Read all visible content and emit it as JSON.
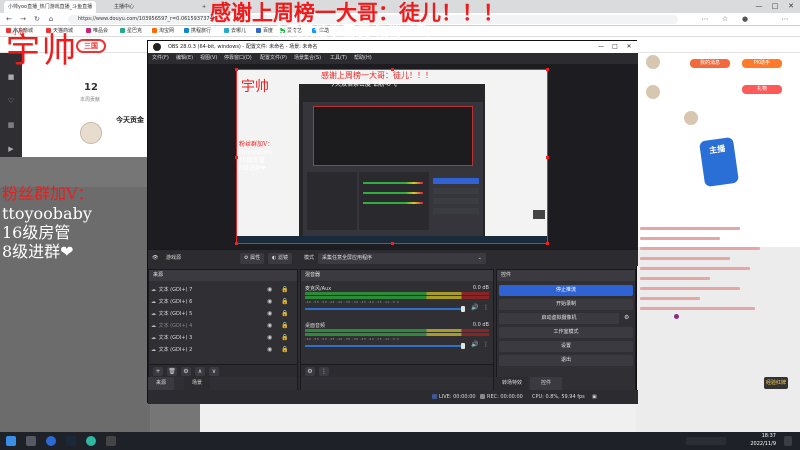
{
  "browser": {
    "tabs": [
      {
        "label": "小帅yoo直播_热门游戏直播_斗鱼直播",
        "active": true
      },
      {
        "label": "主播中心",
        "active": false
      }
    ],
    "new_tab": "+",
    "url": "https://www.douyu.com/103956597_r=0.0615937374",
    "bookmarks": [
      "京东商城",
      "天猫商城",
      "唯品会",
      "星巴克",
      "淘宝网",
      "携程旅行",
      "去哪儿",
      "百度",
      "爱奇艺",
      "优酷"
    ],
    "controls": {
      "minimize": "—",
      "maximize": "□",
      "close": "✕"
    }
  },
  "site": {
    "left_logo": "三国",
    "room_number": "12",
    "room_sub": "本周贡献",
    "today_label": "今天贡金"
  },
  "chat": {
    "buttons": [
      "我的消息",
      "PK助手",
      "礼物"
    ],
    "badge": "主播"
  },
  "sticker_text": "经验红牌",
  "obs": {
    "title": "OBS 28.0.3 (64-bit, windows) - 配置文件: 未命名 - 场景: 未命名",
    "menu": [
      "文件(F)",
      "编辑(E)",
      "视图(V)",
      "停靠窗口(D)",
      "配置文件(P)",
      "场景集合(S)",
      "工具(T)",
      "帮助(H)"
    ],
    "toolbar": {
      "source_name": "游戏源",
      "properties": "属性",
      "filters": "滤镜",
      "mode_label": "模式",
      "mode_value": "采集任意全屏应用程序"
    },
    "sources": {
      "header": "来源",
      "items": [
        "文本 (GDI+) 7",
        "文本 (GDI+) 6",
        "文本 (GDI+) 5",
        "文本 (GDI+) 4",
        "文本 (GDI+) 3",
        "文本 (GDI+) 2"
      ]
    },
    "mixer": {
      "header": "混音器",
      "channels": [
        {
          "name": "麦克风/Aux",
          "db": "0.0 dB"
        },
        {
          "name": "桌面音频",
          "db": "0.0 dB"
        }
      ],
      "ticks": "-60 -55 -50 -45 -40 -35 -30 -25 -20 -15 -10 -5 0"
    },
    "controls": {
      "header": "控件",
      "buttons": [
        "停止推流",
        "开始录制",
        "启动虚拟摄像机",
        "工作室模式",
        "设置",
        "退出"
      ]
    },
    "dock_tabs": [
      "来源",
      "场景",
      "转场特效",
      "控件"
    ],
    "status": {
      "live": "LIVE: 00:00:00",
      "rec": "REC: 00:00:00",
      "cpu": "CPU: 0.8%, 59.94 fps"
    }
  },
  "overlays": {
    "name_small": "小帅",
    "name_large": "宇帅",
    "thanks": "感谢上周榜一大哥：徒儿！！！",
    "double": "今天双倍亲密度 钻粉-6飞",
    "fans_title": "粉丝群加V：",
    "fans_id": "ttoyoobaby",
    "fans_level": "16级房管",
    "fans_join": "8级进群❤"
  },
  "taskbar": {
    "time": "18:37",
    "date": "2022/11/9"
  },
  "colors": {
    "obs_bg": "#2b2b30",
    "accent_blue": "#2f63d4",
    "overlay_red": "#ee1c1c",
    "overlay_white": "#ffffff"
  }
}
